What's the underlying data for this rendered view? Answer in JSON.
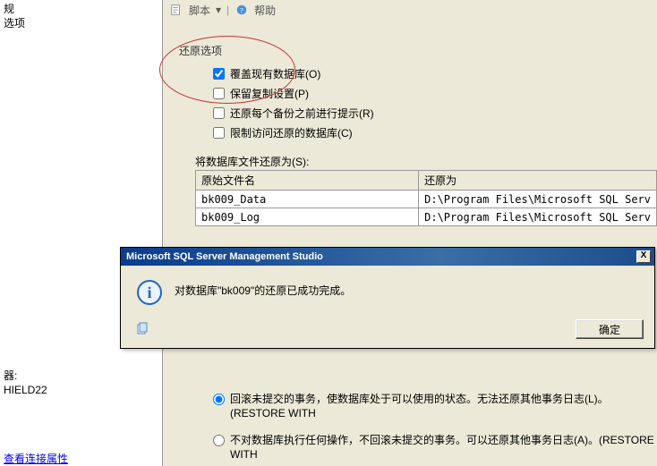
{
  "left": {
    "item1": "规",
    "item2": "选项",
    "sep": "器:",
    "server": "HIELD22",
    "link": "查看连接属性"
  },
  "toolbar": {
    "script": "脚本",
    "help": "帮助"
  },
  "section": {
    "title": "还原选项"
  },
  "opts": {
    "o1": "覆盖现有数据库(O)",
    "o2": "保留复制设置(P)",
    "o3": "还原每个备份之前进行提示(R)",
    "o4": "限制访问还原的数据库(C)"
  },
  "files": {
    "label": "将数据库文件还原为(S):",
    "col1": "原始文件名",
    "col2": "还原为",
    "rows": [
      {
        "name": "bk009_Data",
        "path": "D:\\Program Files\\Microsoft SQL Serv"
      },
      {
        "name": "bk009_Log",
        "path": "D:\\Program Files\\Microsoft SQL Serv"
      }
    ]
  },
  "dialog": {
    "title": "Microsoft SQL Server Management Studio",
    "close": "X",
    "info_glyph": "i",
    "msg": "对数据库\"bk009\"的还原已成功完成。",
    "ok": "确定"
  },
  "radios": {
    "r1": "回滚未提交的事务，使数据库处于可以使用的状态。无法还原其他事务日志(L)。(RESTORE WITH",
    "r2": "不对数据库执行任何操作，不回滚未提交的事务。可以还原其他事务日志(A)。(RESTORE WITH"
  }
}
